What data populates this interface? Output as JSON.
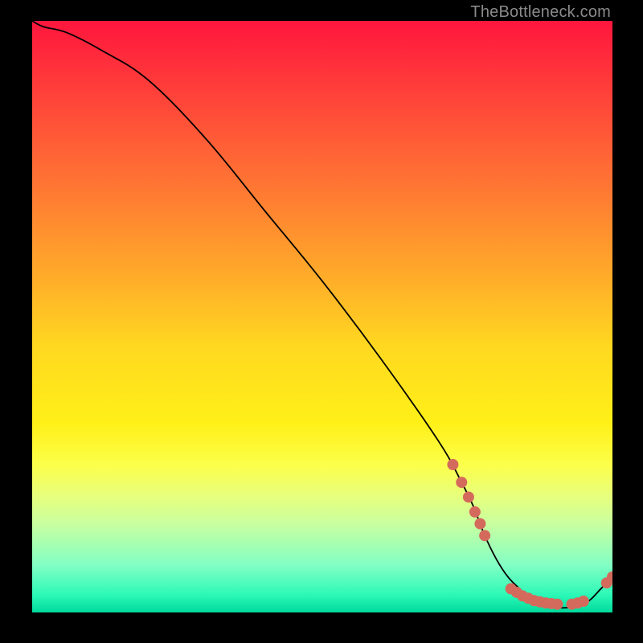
{
  "watermark": "TheBottleneck.com",
  "chart_data": {
    "type": "line",
    "title": "",
    "xlabel": "",
    "ylabel": "",
    "xlim": [
      0,
      100
    ],
    "ylim": [
      0,
      100
    ],
    "x": [
      0,
      2,
      6,
      12,
      20,
      30,
      40,
      50,
      60,
      70,
      74,
      76,
      78,
      80,
      82,
      84,
      86,
      88,
      90,
      92,
      94,
      96,
      98,
      100
    ],
    "values": [
      100,
      99,
      98,
      95,
      90,
      80,
      68,
      56,
      43,
      29,
      22,
      18,
      13,
      9,
      6,
      4,
      2,
      1,
      0.8,
      0.8,
      1,
      2,
      4,
      6
    ],
    "markers": [
      {
        "x": 72.5,
        "y": 25
      },
      {
        "x": 74.0,
        "y": 22
      },
      {
        "x": 75.2,
        "y": 19.5
      },
      {
        "x": 76.3,
        "y": 17
      },
      {
        "x": 77.2,
        "y": 15
      },
      {
        "x": 78.0,
        "y": 13
      },
      {
        "x": 82.5,
        "y": 4.0
      },
      {
        "x": 83.5,
        "y": 3.4
      },
      {
        "x": 84.5,
        "y": 2.8
      },
      {
        "x": 85.5,
        "y": 2.4
      },
      {
        "x": 86.5,
        "y": 2.0
      },
      {
        "x": 87.5,
        "y": 1.8
      },
      {
        "x": 88.5,
        "y": 1.6
      },
      {
        "x": 89.5,
        "y": 1.5
      },
      {
        "x": 90.5,
        "y": 1.4
      },
      {
        "x": 93.0,
        "y": 1.4
      },
      {
        "x": 94.0,
        "y": 1.6
      },
      {
        "x": 95.0,
        "y": 1.9
      },
      {
        "x": 99.0,
        "y": 5.0
      },
      {
        "x": 100.0,
        "y": 6.0
      }
    ],
    "colors": {
      "curve": "#000000",
      "marker_fill": "#d46a5c",
      "marker_stroke": "#d46a5c"
    }
  }
}
